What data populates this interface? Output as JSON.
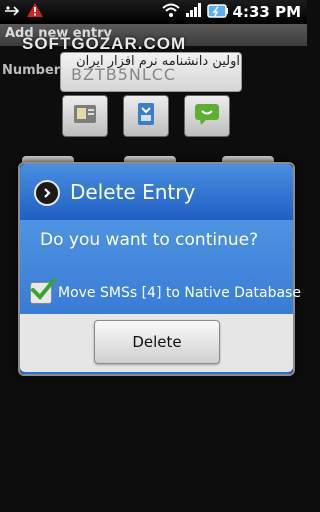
{
  "status_bar": {
    "time": "4:33 PM",
    "icons": [
      "usb-icon",
      "warning-icon",
      "wifi-icon",
      "signal-icon",
      "battery-icon"
    ]
  },
  "titlebar": {
    "title": "Add new entry"
  },
  "watermark": "SOFTGOZAR.COM",
  "form": {
    "number_label": "Number",
    "number_value": "BZTB5NLCC",
    "persian_text": "اولین دانشنامه نرم افزار ایران"
  },
  "dialog": {
    "title": "Delete Entry",
    "message": "Do you want to continue?",
    "checkbox_label": "Move SMSs [4] to Native Database",
    "checkbox_checked": true,
    "button_label": "Delete"
  },
  "colors": {
    "dialog_blue": "#2a6dce",
    "check_green": "#3aa52e"
  }
}
